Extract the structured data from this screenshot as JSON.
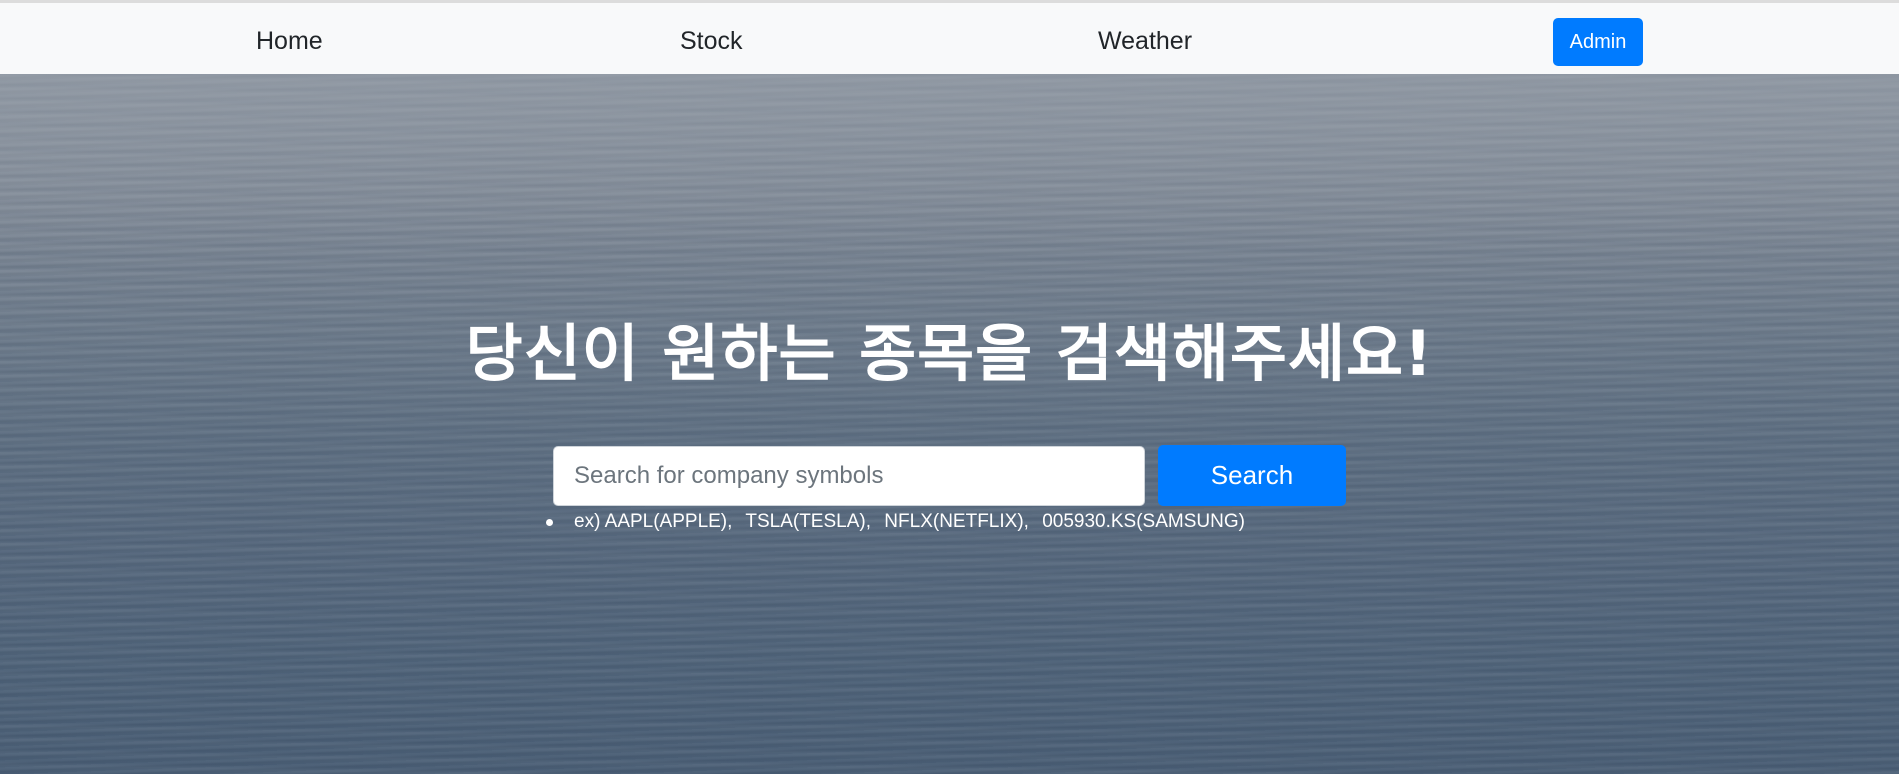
{
  "nav": {
    "home": "Home",
    "stock": "Stock",
    "weather": "Weather",
    "admin": "Admin"
  },
  "hero": {
    "title": "당신이 원하는 종목을 검색해주세요!",
    "search_placeholder": "Search for company symbols",
    "search_button": "Search",
    "examples_prefix": "ex)",
    "examples": [
      "AAPL(APPLE),",
      "TSLA(TESLA),",
      "NFLX(NETFLIX),",
      "005930.KS(SAMSUNG)"
    ]
  },
  "colors": {
    "primary": "#007bff",
    "navbar_bg": "#f8f9fa",
    "hero_text": "#ffffff"
  }
}
